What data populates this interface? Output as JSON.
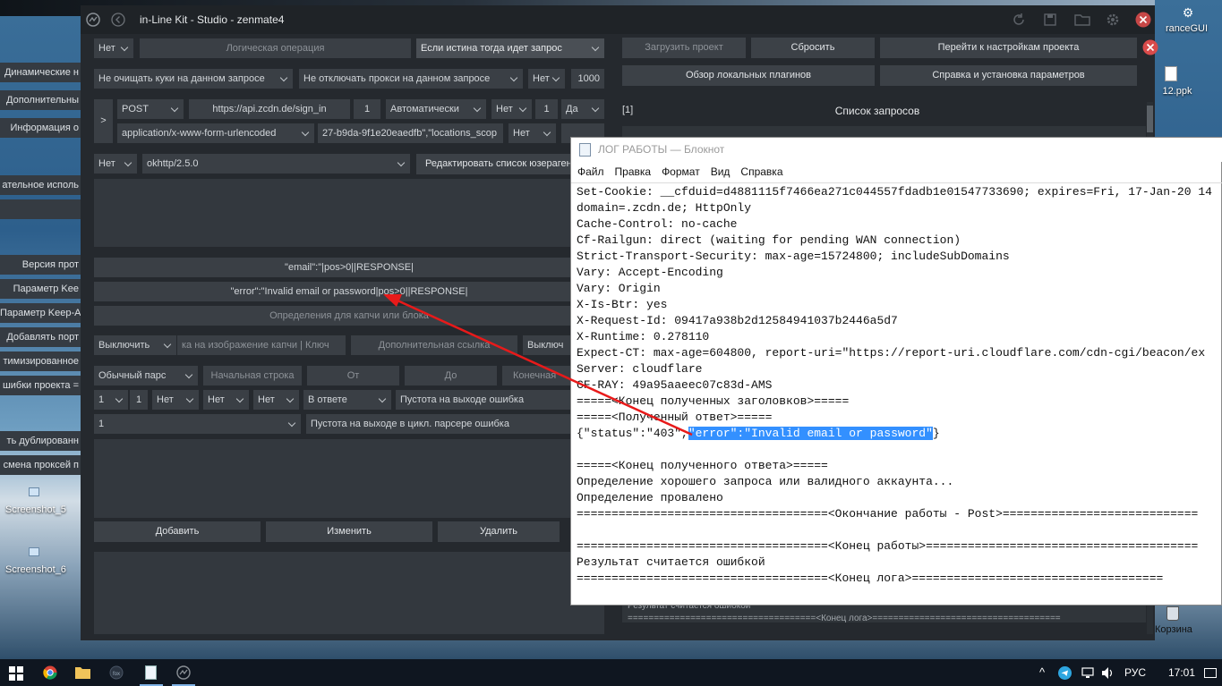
{
  "desktop": {
    "right_icons": [
      {
        "label": "ranceGUI"
      },
      {
        "label": "12.ppk"
      },
      {
        "label": "Корзина"
      }
    ],
    "left_icons": [
      {
        "label": "Screenshot_5"
      },
      {
        "label": "Screenshot_6"
      }
    ]
  },
  "left_clipped": [
    "Динамические н",
    "Дополнительны",
    "Информация о",
    "ательное исполь",
    "Версия прот",
    "Параметр Kee",
    "Параметр Keep-Al",
    "Добавлять порт",
    "тимизированное",
    "шибки проекта =",
    "ть дублированн",
    "смена проксей п"
  ],
  "window": {
    "title": "in-Line Kit - Studio - zenmate4"
  },
  "form": {
    "r1": {
      "a": "Нет",
      "b": "Логическая операция",
      "c": "Если истина тогда идет запрос"
    },
    "r2": {
      "a": "Не очищать куки на данном запросе",
      "b": "Не отключать прокси на данном запросе",
      "c": "Нет",
      "d": "1000"
    },
    "r3": {
      "expand": ">",
      "method": "POST",
      "url": "https://api.zcdn.de/sign_in",
      "n": "1",
      "auto": "Автоматически",
      "no": "Нет",
      "one": "1",
      "yes": "Да"
    },
    "r4": {
      "ctype": "application/x-www-form-urlencoded",
      "body": "27-b9da-9f1e20eaedfb\",\"locations_scop",
      "no": "Нет"
    },
    "r5": {
      "a": "Нет",
      "ua": "okhttp/2.5.0",
      "edit": "Редактировать список юзерагентов"
    },
    "good": "\"email\":\"|pos>0||RESPONSE|",
    "bad": "\"error\":\"Invalid email or password|pos>0||RESPONSE|",
    "captcha": "Определения для капчи или блока",
    "r9": {
      "a": "Выключить",
      "b": "ка на изображение капчи | Ключ",
      "c": "Дополнительная ссылка",
      "d": "Выключ"
    },
    "r10": {
      "a": "Обычный парс",
      "b": "Начальная строка",
      "c": "От",
      "d": "До",
      "e": "Конечная"
    },
    "r11": {
      "a": "1",
      "b": "1",
      "c": "Нет",
      "d": "Нет",
      "e": "Нет",
      "f": "В ответе",
      "g": "Пустота на выходе ошибка"
    },
    "r12": {
      "a": "1",
      "b": "Пустота на выходе в цикл. парсере ошибка"
    },
    "actions": {
      "add": "Добавить",
      "edit": "Изменить",
      "del": "Удалить"
    }
  },
  "right_panel": {
    "load": "Загрузить проект",
    "reset": "Сбросить",
    "goto": "Перейти к настройкам проекта",
    "plugins": "Обзор локальных плагинов",
    "help": "Справка и установка параметров",
    "idx": "[1]",
    "list": "Список запросов",
    "log_tail": [
      "Результат считается ошибкой",
      "====================================<Конец лога>===================================="
    ]
  },
  "notepad": {
    "title": "ЛОГ РАБОТЫ — Блокнот",
    "menu": [
      "Файл",
      "Правка",
      "Формат",
      "Вид",
      "Справка"
    ],
    "lines": [
      "Set-Cookie: __cfduid=d4881115f7466ea271c044557fdadb1e01547733690; expires=Fri, 17-Jan-20 14",
      "domain=.zcdn.de; HttpOnly",
      "Cache-Control: no-cache",
      "Cf-Railgun: direct (waiting for pending WAN connection)",
      "Strict-Transport-Security: max-age=15724800; includeSubDomains",
      "Vary: Accept-Encoding",
      "Vary: Origin",
      "X-Is-Btr: yes",
      "X-Request-Id: 09417a938b2d12584941037b2446a5d7",
      "X-Runtime: 0.278110",
      "Expect-CT: max-age=604800, report-uri=\"https://report-uri.cloudflare.com/cdn-cgi/beacon/ex",
      "Server: cloudflare",
      "CF-RAY: 49a95aaeec07c83d-AMS",
      "=====<Конец полученных заголовков>=====",
      "=====<Полученный ответ>=====",
      {
        "pre": "{\"status\":\"403\",",
        "hl": "\"error\":\"Invalid email or password\"",
        "post": "}"
      },
      "",
      "=====<Конец полученного ответа>=====",
      "Определение хорошего запроса или валидного аккаунта...",
      "Определение провалено",
      "====================================<Окончание работы - Post>============================",
      "",
      "====================================<Конец работы>=======================================",
      "Результат считается ошибкой",
      "====================================<Конец лога>===================================="
    ]
  },
  "taskbar": {
    "lang": "РУС",
    "time": "17:01",
    "chevron": "^"
  }
}
